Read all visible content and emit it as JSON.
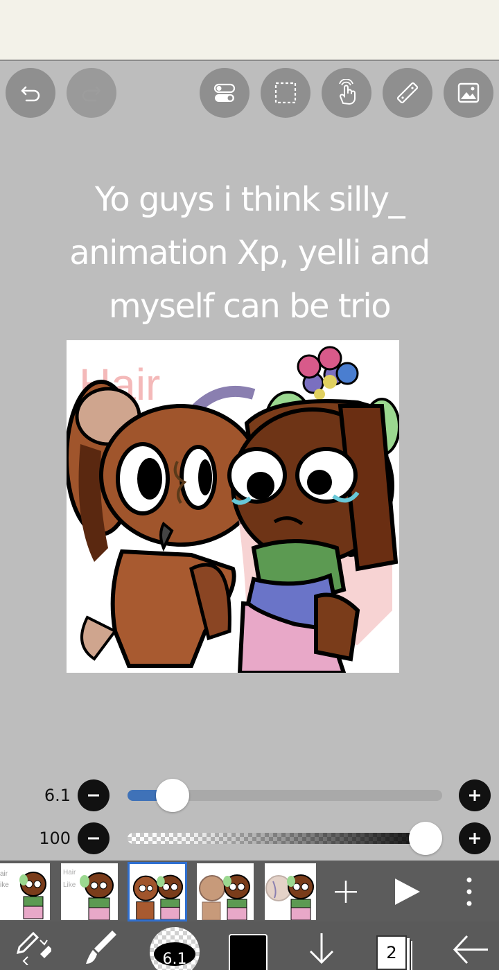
{
  "top_toolbar": {
    "buttons": [
      {
        "name": "undo",
        "icon": "undo-icon",
        "enabled": true
      },
      {
        "name": "redo",
        "icon": "redo-icon",
        "enabled": false
      },
      {
        "name": "toggle",
        "icon": "toggle-switches-icon",
        "enabled": true
      },
      {
        "name": "selection",
        "icon": "selection-marquee-icon",
        "enabled": true
      },
      {
        "name": "gesture",
        "icon": "tap-hand-icon",
        "enabled": true
      },
      {
        "name": "ruler",
        "icon": "ruler-icon",
        "enabled": true
      },
      {
        "name": "gallery",
        "icon": "image-icon",
        "enabled": true
      }
    ]
  },
  "canvas": {
    "caption_lines": [
      "Yo guys i think silly_",
      "animation Xp, yelli and",
      "myself can be trio"
    ],
    "artwork_text": "Hair"
  },
  "sliders": {
    "brush_size": {
      "value_label": "6.1",
      "fraction": 0.1
    },
    "opacity": {
      "value_label": "100",
      "fraction": 1.0
    }
  },
  "frame_strip": {
    "frames": [
      {
        "label": "air\nike",
        "active": false
      },
      {
        "label": "Hair\nLike",
        "active": false
      },
      {
        "label": "",
        "active": true
      },
      {
        "label": "",
        "active": false
      },
      {
        "label": "",
        "active": false
      }
    ],
    "add_icon": "plus-icon",
    "play_icon": "play-icon",
    "menu_icon": "more-vertical-icon"
  },
  "bottom_bar": {
    "brush_size_label": "6.1",
    "layer_count": "2",
    "current_color": "#000000"
  },
  "colors": {
    "background": "#bdbdbd",
    "button": "#8f8f8f",
    "accent": "#3f72b8",
    "bottom_bar": "#5a5a5a",
    "active_frame": "#2f6fd0"
  }
}
